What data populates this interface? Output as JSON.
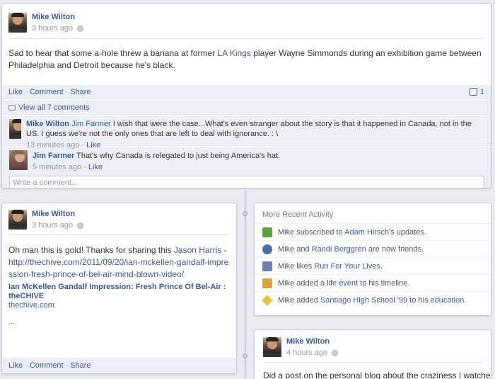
{
  "post1": {
    "author": "Mike Wilton",
    "time": "3 hours ago",
    "text_before": "Sad to hear that some a-hole threw a banana at former ",
    "text_link": "LA Kings",
    "text_after": " player Wayne Simmonds during an exhibition game between Philadelphia and Detroit because he's black.",
    "actions": {
      "like": "Like",
      "comment": "Comment",
      "share": "Share",
      "sep": "·"
    },
    "like_count": "1",
    "view_comments": "View all 7 comments",
    "comments": [
      {
        "author": "Mike Wilton",
        "mention": "Jim Farmer",
        "text": " I wish that were the case...What's even stranger about the story is that it happened in Canada, not in the US. I guess we're not the only ones that are left to deal with ignorance. : \\",
        "time": "13 minutes ago",
        "like": "Like"
      },
      {
        "author": "Jim Farmer",
        "text": " That's why Canada is relegated to just being America's hat.",
        "time": "5 minutes ago",
        "like": "Like"
      }
    ],
    "comment_placeholder": "Write a comment..."
  },
  "post2": {
    "author": "Mike Wilton",
    "time": "3 hours ago",
    "text_before": "Oh man this is gold! Thanks for sharing this ",
    "text_link": "Jason Harris",
    "text_after": " - ",
    "url": "http://thechive.com/2011/09/20/ian-mckellen-gandalf-impression-fresh-prince-of-bel-air-mind-blown-video/",
    "attachment_title": "Ian McKellen Gandalf Impression: Fresh Prince Of Bel-Air : theCHIVE",
    "attachment_domain": "thechive.com",
    "ellipsis": "...",
    "actions": {
      "like": "Like",
      "comment": "Comment",
      "share": "Share",
      "sep": "·"
    }
  },
  "activity": {
    "title": "More Recent Activity",
    "items": [
      {
        "pre": "Mike subscribed to ",
        "link": "Adam Hirsch",
        "post": "'s updates.",
        "icon": "subscribe-icon"
      },
      {
        "pre": "Mike and ",
        "link": "Randi Berggren",
        "post": " are now friends.",
        "icon": "friends-icon"
      },
      {
        "pre": "Mike likes ",
        "link": "Run For Your Lives",
        "post": ".",
        "icon": "like-page-icon"
      },
      {
        "pre": "Mike added ",
        "link": "a life event",
        "post": " to his timeline.",
        "icon": "life-event-icon"
      },
      {
        "pre": "Mike added ",
        "link": "Santiago High School '99",
        "post": " to his ",
        "link2": "education",
        "post2": ".",
        "icon": "education-icon"
      }
    ]
  },
  "post3": {
    "author": "Mike Wilton",
    "time": "4 hours ago",
    "text": "Did a post on the personal blog about the craziness I watched"
  },
  "colors": {
    "link": "#3b5998",
    "background": "#e9ebee",
    "ufi": "#eceff5"
  }
}
